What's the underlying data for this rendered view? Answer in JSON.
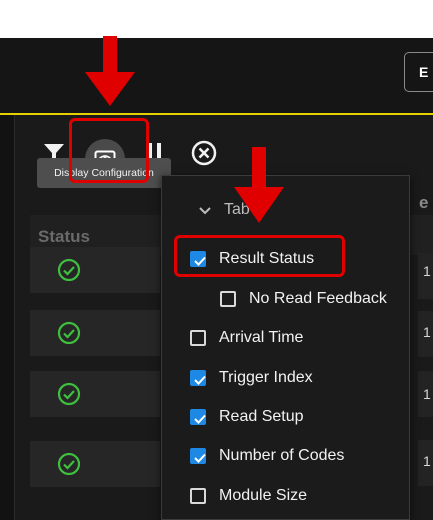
{
  "header": {
    "export_button_label": "E"
  },
  "toolbar": {
    "filter_icon": "filter-icon",
    "display_config_icon": "eye-config-icon",
    "pause_icon": "pause-icon",
    "clear_icon": "clear-circle-x-icon"
  },
  "tooltip": {
    "text": "Display Configuration"
  },
  "table": {
    "status_header": "Status",
    "right_header": "e",
    "rows": [
      {
        "status": "check-circle-icon",
        "right_value": "1"
      },
      {
        "status": "check-circle-icon",
        "right_value": "1"
      },
      {
        "status": "check-circle-icon",
        "right_value": "1"
      },
      {
        "status": "check-circle-icon",
        "right_value": "1"
      }
    ]
  },
  "dropdown": {
    "section_label": "Tab",
    "items": [
      {
        "label": "Result Status",
        "checked": true
      },
      {
        "label": "No Read Feedback",
        "checked": false
      },
      {
        "label": "Arrival Time",
        "checked": false
      },
      {
        "label": "Trigger Index",
        "checked": true
      },
      {
        "label": "Read Setup",
        "checked": true
      },
      {
        "label": "Number of Codes",
        "checked": true
      },
      {
        "label": "Module Size",
        "checked": false
      }
    ]
  },
  "colors": {
    "accent_yellow": "#e7d000",
    "annotation_red": "#e10000",
    "check_green": "#3fbf3f",
    "checkbox_blue": "#1e88e5"
  }
}
